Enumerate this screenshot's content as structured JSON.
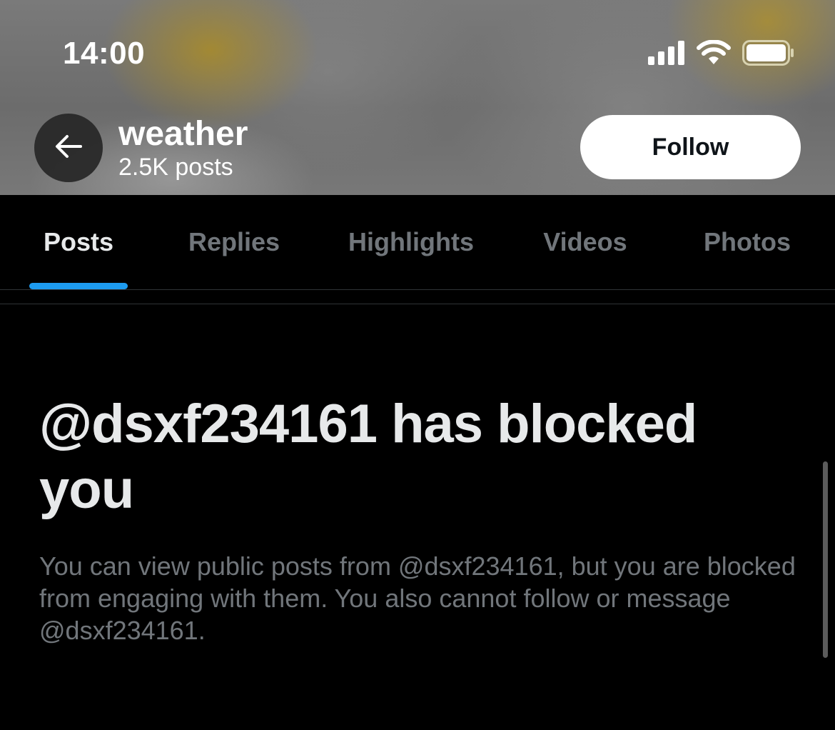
{
  "status_bar": {
    "time": "14:00",
    "icons": [
      "cellular-signal-icon",
      "wifi-icon",
      "battery-icon"
    ]
  },
  "header": {
    "back_icon": "arrow-left-icon",
    "profile_name": "weather",
    "post_count": "2.5K posts",
    "follow_label": "Follow"
  },
  "tabs": [
    {
      "label": "Posts",
      "active": true
    },
    {
      "label": "Replies",
      "active": false
    },
    {
      "label": "Highlights",
      "active": false
    },
    {
      "label": "Videos",
      "active": false
    },
    {
      "label": "Photos",
      "active": false
    }
  ],
  "blocked": {
    "title": "@dsxf234161 has blocked you",
    "description": "You can view public posts from @dsxf234161, but you are blocked from engaging with them. You also cannot follow or message @dsxf234161."
  },
  "colors": {
    "accent": "#1d9bf0",
    "background": "#000000",
    "primary_text": "#e7e9ea",
    "secondary_text": "#71767b"
  }
}
